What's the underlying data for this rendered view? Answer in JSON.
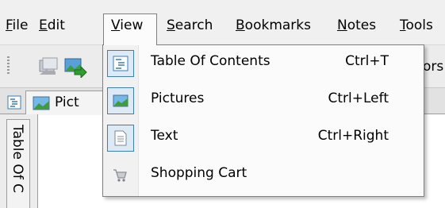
{
  "menubar": {
    "items": [
      {
        "label": "File",
        "mnemonic": "F",
        "rest": "ile"
      },
      {
        "label": "Edit",
        "mnemonic": "E",
        "rest": "dit"
      },
      {
        "label": "View",
        "mnemonic": "V",
        "rest": "iew"
      },
      {
        "label": "Search",
        "mnemonic": "S",
        "rest": "earch"
      },
      {
        "label": "Bookmarks",
        "mnemonic": "B",
        "rest": "ookmarks"
      },
      {
        "label": "Notes",
        "mnemonic": "N",
        "rest": "otes"
      },
      {
        "label": "Tools",
        "mnemonic": "T",
        "rest": "ools"
      }
    ]
  },
  "toolbar": {
    "partial_text": "ors"
  },
  "tabs": {
    "pictures_label": "Pict"
  },
  "sidepanel": {
    "vertical_label": "Table Of C"
  },
  "view_menu": {
    "items": [
      {
        "label": "Table Of Contents",
        "shortcut": "Ctrl+T",
        "icon": "table-of-contents-icon",
        "checked": true
      },
      {
        "label": "Pictures",
        "shortcut": "Ctrl+Left",
        "icon": "pictures-icon",
        "checked": true
      },
      {
        "label": "Text",
        "shortcut": "Ctrl+Right",
        "icon": "text-document-icon",
        "checked": true
      },
      {
        "label": "Shopping Cart",
        "shortcut": "",
        "icon": "shopping-cart-icon",
        "checked": false
      }
    ]
  },
  "colors": {
    "menubar_bg": "#f0f0f0",
    "checked_border": "#3c7fb1",
    "checked_fill": "#dde9f5"
  }
}
